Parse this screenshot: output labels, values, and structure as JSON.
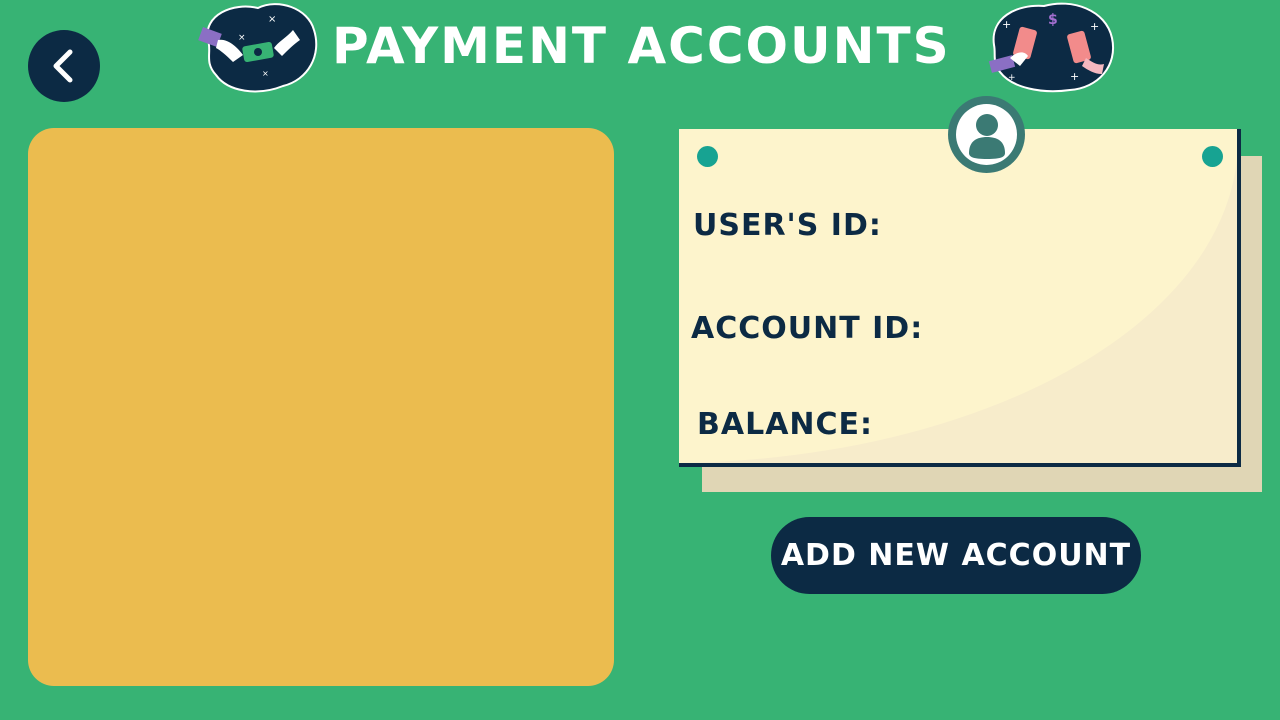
{
  "header": {
    "title": "PAYMENT ACCOUNTS",
    "back_icon": "chevron-left-icon"
  },
  "card": {
    "user_id_label": "USER'S ID:",
    "account_id_label": "ACCOUNT ID:",
    "balance_label": "BALANCE:",
    "avatar_icon": "user-icon"
  },
  "actions": {
    "add_account_label": "ADD NEW ACCOUNT"
  },
  "colors": {
    "background": "#37b374",
    "navy": "#0c2a44",
    "panel": "#ebbc4f",
    "card": "#fdf4cc",
    "pin": "#17a392"
  }
}
